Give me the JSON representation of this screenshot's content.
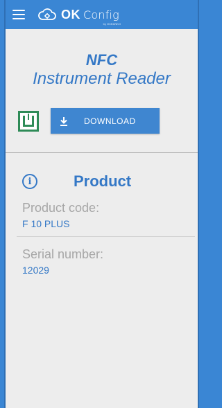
{
  "header": {
    "brand_ok": "OK",
    "brand_config": "Config",
    "brand_sub": "by OCEANKO",
    "menu_icon": "hamburger-icon",
    "logo_icon": "cloud-gear-icon"
  },
  "title": {
    "line1": "NFC",
    "line2": "Instrument Reader"
  },
  "actions": {
    "nfc_icon": "nfc-icon",
    "download_label": "DOWNLOAD",
    "download_icon": "download-icon"
  },
  "product": {
    "section_title": "Product",
    "info_icon": "info-icon",
    "fields": [
      {
        "label": "Product code:",
        "value": "F 10 PLUS"
      },
      {
        "label": "Serial number:",
        "value": "12029"
      }
    ]
  },
  "colors": {
    "accent": "#3478c6",
    "topbar": "#3a86d4",
    "nfc_green": "#2e8b57",
    "background": "#ededed"
  }
}
